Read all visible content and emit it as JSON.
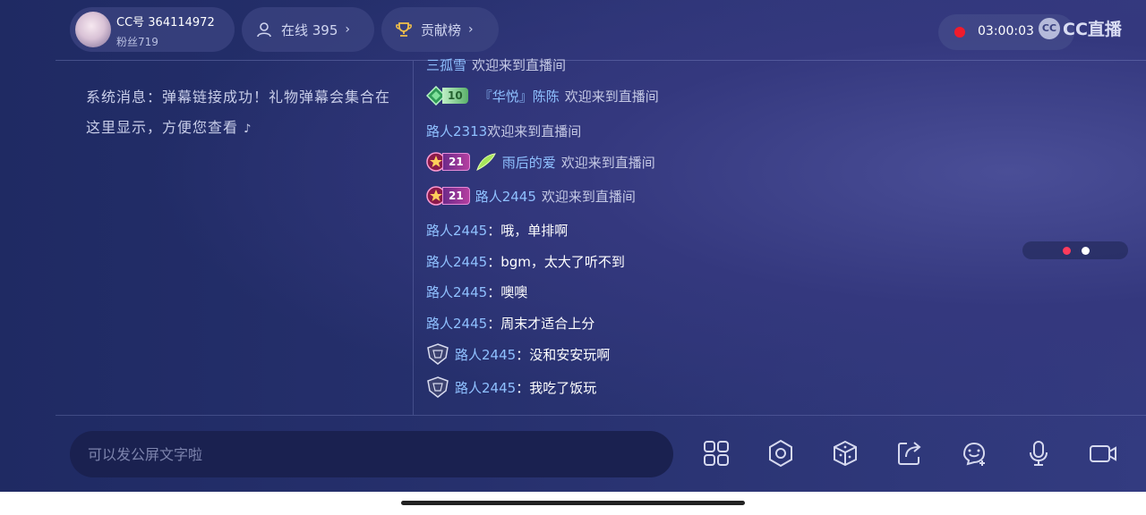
{
  "anchor": {
    "id_label": "CC号 364114972",
    "fans_label": "粉丝719"
  },
  "online": {
    "label": "在线 395"
  },
  "contrib": {
    "label": "贡献榜"
  },
  "recording": {
    "time": "03:00:03"
  },
  "logo": {
    "text": "CC直播"
  },
  "system_message": "系统消息：弹幕链接成功！礼物弹幕会集合在这里显示，方便您查看",
  "chat": [
    {
      "nick": "三孤雪",
      "text": "欢迎来到直播间",
      "type": "welcome"
    },
    {
      "level": "10",
      "nick": "『华悦』陈陈",
      "text": "欢迎来到直播间",
      "type": "welcome"
    },
    {
      "nick": "路人2313",
      "text": "欢迎来到直播间",
      "type": "welcome"
    },
    {
      "level": "21",
      "nick": "雨后的爱",
      "text": "欢迎来到直播间",
      "type": "welcome"
    },
    {
      "level": "21",
      "nick": "路人2445",
      "text": "欢迎来到直播间",
      "type": "welcome"
    },
    {
      "nick": "路人2445",
      "sep": "：",
      "text": "哦，单排啊",
      "type": "chat"
    },
    {
      "nick": "路人2445",
      "sep": "：",
      "text": "bgm，太大了听不到",
      "type": "chat"
    },
    {
      "nick": "路人2445",
      "sep": "：",
      "text": "噢噢",
      "type": "chat"
    },
    {
      "nick": "路人2445",
      "sep": "：",
      "text": "周末才适合上分",
      "type": "chat"
    },
    {
      "nick": "路人2445",
      "sep": "：",
      "text": "没和安安玩啊",
      "type": "chat"
    },
    {
      "nick": "路人2445",
      "sep": "：",
      "text": "我吃了饭玩",
      "type": "chat"
    }
  ],
  "input": {
    "placeholder": "可以发公屏文字啦"
  },
  "toolbar": [
    "grid-icon",
    "settings-icon",
    "gift-box-icon",
    "share-icon",
    "emoji-icon",
    "microphone-icon",
    "camera-icon"
  ],
  "colors": {
    "accent_red": "#f01b2c",
    "nick_blue": "#8fc0ff"
  }
}
